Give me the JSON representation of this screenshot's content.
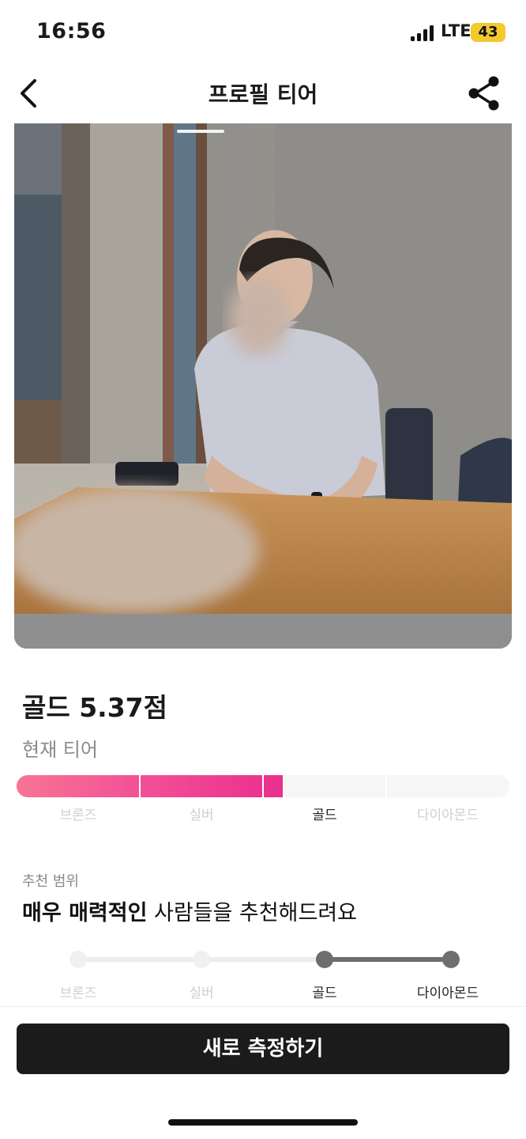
{
  "status_bar": {
    "time": "16:56",
    "network": "LTE",
    "battery": "43"
  },
  "header": {
    "title": "프로필 티어",
    "back_icon": "chevron-left-icon",
    "share_icon": "share-icon"
  },
  "photo": {
    "description_icon": "profile-photo",
    "page_count": 1,
    "current_page": 1
  },
  "tier": {
    "score_text": "골드 5.37점",
    "caption": "현재 티어",
    "tiers": [
      "브론즈",
      "실버",
      "골드",
      "다이아몬드"
    ],
    "current_index": 2,
    "progress_fraction": 0.54,
    "accent_color": "#f35196"
  },
  "recommendation": {
    "caption": "추천 범위",
    "headline_bold": "매우 매력적인",
    "headline_rest": " 사람들을 추천해드려요",
    "labels": [
      "브론즈",
      "실버",
      "골드",
      "다이아몬드"
    ],
    "range_start_index": 2,
    "range_end_index": 3
  },
  "cta": {
    "label": "새로 측정하기"
  }
}
